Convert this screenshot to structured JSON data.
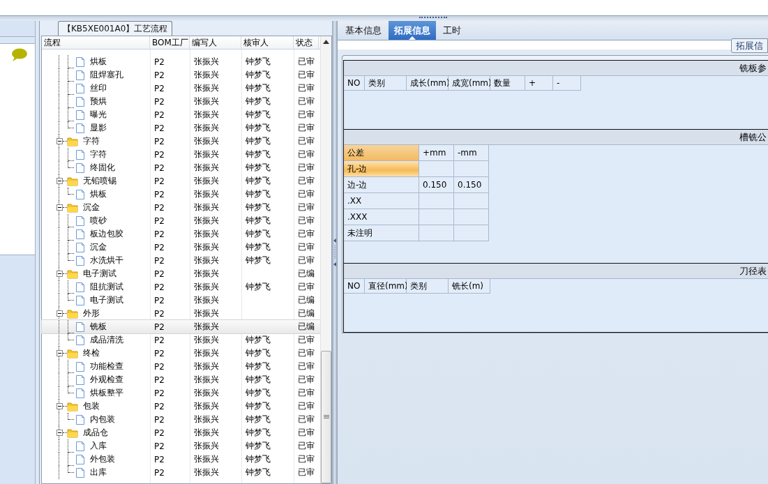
{
  "process_panel": {
    "title": "【KB5XE001A0】工艺流程",
    "columns": [
      "流程",
      "BOM工厂",
      "编写人",
      "核审人",
      "状态"
    ],
    "groups": [
      {
        "children": [
          {
            "label": "烘板",
            "bom": "P2",
            "author": "张振兴",
            "reviewer": "钟梦飞",
            "status": "已审",
            "selected": false
          },
          {
            "label": "阻焊塞孔",
            "bom": "P2",
            "author": "张振兴",
            "reviewer": "钟梦飞",
            "status": "已审",
            "selected": false
          },
          {
            "label": "丝印",
            "bom": "P2",
            "author": "张振兴",
            "reviewer": "钟梦飞",
            "status": "已审",
            "selected": false
          },
          {
            "label": "预烘",
            "bom": "P2",
            "author": "张振兴",
            "reviewer": "钟梦飞",
            "status": "已审",
            "selected": false
          },
          {
            "label": "曝光",
            "bom": "P2",
            "author": "张振兴",
            "reviewer": "钟梦飞",
            "status": "已审",
            "selected": false
          },
          {
            "label": "显影",
            "bom": "P2",
            "author": "张振兴",
            "reviewer": "钟梦飞",
            "status": "已审",
            "selected": false
          }
        ]
      },
      {
        "label": "字符",
        "expanded": true,
        "bom": "P2",
        "author": "张振兴",
        "reviewer": "钟梦飞",
        "status": "已审",
        "selected": false,
        "children": [
          {
            "label": "字符",
            "bom": "P2",
            "author": "张振兴",
            "reviewer": "钟梦飞",
            "status": "已审",
            "selected": false
          },
          {
            "label": "终固化",
            "bom": "P2",
            "author": "张振兴",
            "reviewer": "钟梦飞",
            "status": "已审",
            "selected": false
          }
        ]
      },
      {
        "label": "无铅喷锡",
        "expanded": true,
        "bom": "P2",
        "author": "张振兴",
        "reviewer": "钟梦飞",
        "status": "已审",
        "selected": false,
        "children": [
          {
            "label": "烘板",
            "bom": "P2",
            "author": "张振兴",
            "reviewer": "钟梦飞",
            "status": "已审",
            "selected": false
          }
        ]
      },
      {
        "label": "沉金",
        "expanded": true,
        "bom": "P2",
        "author": "张振兴",
        "reviewer": "钟梦飞",
        "status": "已审",
        "selected": false,
        "children": [
          {
            "label": "喷砂",
            "bom": "P2",
            "author": "张振兴",
            "reviewer": "钟梦飞",
            "status": "已审",
            "selected": false
          },
          {
            "label": "板边包胶",
            "bom": "P2",
            "author": "张振兴",
            "reviewer": "钟梦飞",
            "status": "已审",
            "selected": false
          },
          {
            "label": "沉金",
            "bom": "P2",
            "author": "张振兴",
            "reviewer": "钟梦飞",
            "status": "已审",
            "selected": false
          },
          {
            "label": "水洗烘干",
            "bom": "P2",
            "author": "张振兴",
            "reviewer": "钟梦飞",
            "status": "已审",
            "selected": false
          }
        ]
      },
      {
        "label": "电子测试",
        "expanded": true,
        "bom": "P2",
        "author": "张振兴",
        "status": "已编",
        "selected": false,
        "children": [
          {
            "label": "阻抗测试",
            "bom": "P2",
            "author": "张振兴",
            "reviewer": "钟梦飞",
            "status": "已审",
            "selected": false
          },
          {
            "label": "电子测试",
            "bom": "P2",
            "author": "张振兴",
            "status": "已编",
            "selected": false
          }
        ]
      },
      {
        "label": "外形",
        "expanded": true,
        "bom": "P2",
        "author": "张振兴",
        "status": "已编",
        "selected": false,
        "children": [
          {
            "label": "铣板",
            "bom": "P2",
            "author": "张振兴",
            "status": "已编",
            "selected": true
          },
          {
            "label": "成品清洗",
            "bom": "P2",
            "author": "张振兴",
            "reviewer": "钟梦飞",
            "status": "已审",
            "selected": false
          }
        ]
      },
      {
        "label": "终检",
        "expanded": true,
        "bom": "P2",
        "author": "张振兴",
        "reviewer": "钟梦飞",
        "status": "已审",
        "selected": false,
        "children": [
          {
            "label": "功能检查",
            "bom": "P2",
            "author": "张振兴",
            "reviewer": "钟梦飞",
            "status": "已审",
            "selected": false
          },
          {
            "label": "外观检查",
            "bom": "P2",
            "author": "张振兴",
            "reviewer": "钟梦飞",
            "status": "已审",
            "selected": false
          },
          {
            "label": "烘板整平",
            "bom": "P2",
            "author": "张振兴",
            "reviewer": "钟梦飞",
            "status": "已审",
            "selected": false
          }
        ]
      },
      {
        "label": "包装",
        "expanded": true,
        "bom": "P2",
        "author": "张振兴",
        "reviewer": "钟梦飞",
        "status": "已审",
        "selected": false,
        "children": [
          {
            "label": "内包装",
            "bom": "P2",
            "author": "张振兴",
            "reviewer": "钟梦飞",
            "status": "已审",
            "selected": false
          }
        ]
      },
      {
        "label": "成品仓",
        "expanded": true,
        "bom": "P2",
        "author": "张振兴",
        "reviewer": "钟梦飞",
        "status": "已审",
        "selected": false,
        "children": [
          {
            "label": "入库",
            "bom": "P2",
            "author": "张振兴",
            "reviewer": "钟梦飞",
            "status": "已审",
            "selected": false
          },
          {
            "label": "外包装",
            "bom": "P2",
            "author": "张振兴",
            "reviewer": "钟梦飞",
            "status": "已审",
            "selected": false
          },
          {
            "label": "出库",
            "bom": "P2",
            "author": "张振兴",
            "reviewer": "钟梦飞",
            "status": "已审",
            "selected": false
          }
        ]
      }
    ]
  },
  "detail_panel": {
    "tabs": [
      {
        "label": "基本信息",
        "selected": false
      },
      {
        "label": "拓展信息",
        "selected": true
      },
      {
        "label": "工时",
        "selected": false
      }
    ],
    "side_button": "拓展信",
    "sections": [
      {
        "kind": "columns",
        "title": "铣板参",
        "columns": [
          "NO",
          "类别",
          "成长(mm)",
          "成宽(mm)",
          "数量",
          "+",
          "-"
        ]
      },
      {
        "kind": "tolerance",
        "title": "槽铣公",
        "columns": [
          "公差",
          "+mm",
          "-mm"
        ],
        "rows": [
          {
            "label": "孔-边",
            "selected": true
          },
          {
            "label": "边-边",
            "plus": "0.150",
            "minus": "0.150",
            "selected": false
          },
          {
            "label": ".XX",
            "selected": false
          },
          {
            "label": ".XXX",
            "selected": false
          },
          {
            "label": "未注明",
            "selected": false
          }
        ]
      },
      {
        "kind": "columns",
        "title": "刀径表",
        "columns": [
          "NO",
          "直径(mm)",
          "类别",
          "铣长(m)"
        ]
      }
    ]
  }
}
